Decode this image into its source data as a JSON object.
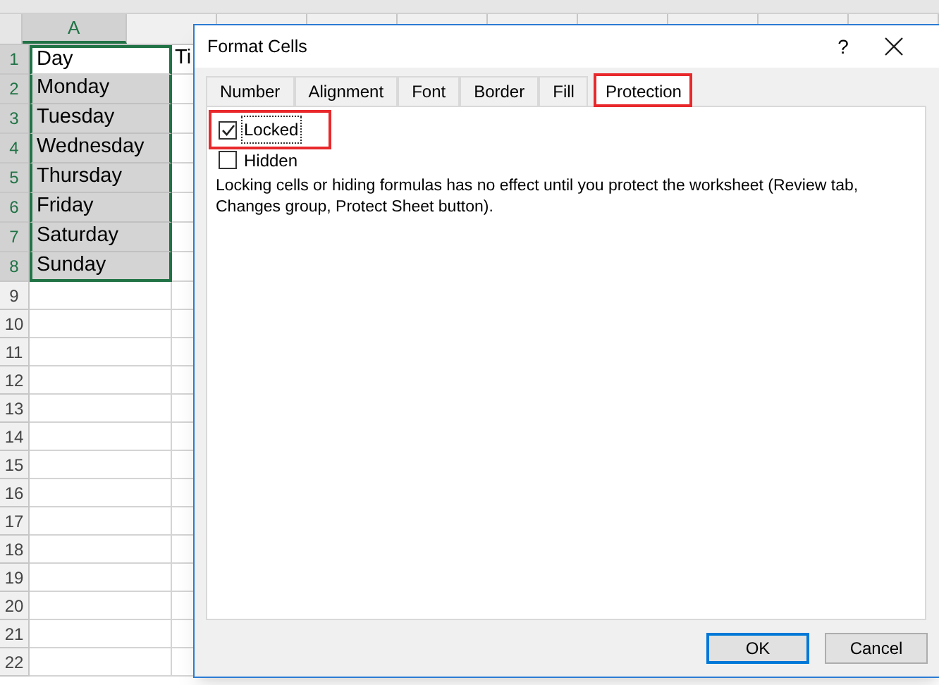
{
  "sheet": {
    "column_header": {
      "label": "A",
      "selected": true
    },
    "rows": [
      {
        "number": "1",
        "selected": true,
        "highlighted": false,
        "cells": [
          "Day",
          "Ti"
        ]
      },
      {
        "number": "2",
        "selected": true,
        "highlighted": true,
        "cells": [
          "Monday"
        ]
      },
      {
        "number": "3",
        "selected": true,
        "highlighted": true,
        "cells": [
          "Tuesday"
        ]
      },
      {
        "number": "4",
        "selected": true,
        "highlighted": true,
        "cells": [
          "Wednesday"
        ]
      },
      {
        "number": "5",
        "selected": true,
        "highlighted": true,
        "cells": [
          "Thursday"
        ]
      },
      {
        "number": "6",
        "selected": true,
        "highlighted": true,
        "cells": [
          "Friday"
        ]
      },
      {
        "number": "7",
        "selected": true,
        "highlighted": true,
        "cells": [
          "Saturday"
        ]
      },
      {
        "number": "8",
        "selected": true,
        "highlighted": true,
        "cells": [
          "Sunday"
        ]
      },
      {
        "number": "9",
        "selected": false,
        "highlighted": false,
        "cells": []
      },
      {
        "number": "10",
        "selected": false,
        "highlighted": false,
        "cells": []
      },
      {
        "number": "11",
        "selected": false,
        "highlighted": false,
        "cells": []
      },
      {
        "number": "12",
        "selected": false,
        "highlighted": false,
        "cells": []
      },
      {
        "number": "13",
        "selected": false,
        "highlighted": false,
        "cells": []
      },
      {
        "number": "14",
        "selected": false,
        "highlighted": false,
        "cells": []
      },
      {
        "number": "15",
        "selected": false,
        "highlighted": false,
        "cells": []
      },
      {
        "number": "16",
        "selected": false,
        "highlighted": false,
        "cells": []
      },
      {
        "number": "17",
        "selected": false,
        "highlighted": false,
        "cells": []
      },
      {
        "number": "18",
        "selected": false,
        "highlighted": false,
        "cells": []
      },
      {
        "number": "19",
        "selected": false,
        "highlighted": false,
        "cells": []
      },
      {
        "number": "20",
        "selected": false,
        "highlighted": false,
        "cells": []
      },
      {
        "number": "21",
        "selected": false,
        "highlighted": false,
        "cells": []
      },
      {
        "number": "22",
        "selected": false,
        "highlighted": false,
        "cells": []
      }
    ]
  },
  "dialog": {
    "title": "Format Cells",
    "help": "?",
    "tabs": [
      {
        "label": "Number",
        "selected": false,
        "highlighted": false
      },
      {
        "label": "Alignment",
        "selected": false,
        "highlighted": false
      },
      {
        "label": "Font",
        "selected": false,
        "highlighted": false
      },
      {
        "label": "Border",
        "selected": false,
        "highlighted": false
      },
      {
        "label": "Fill",
        "selected": false,
        "highlighted": false
      },
      {
        "label": "Protection",
        "selected": true,
        "highlighted": true
      }
    ],
    "checkboxes": [
      {
        "label": "Locked",
        "checked": true,
        "focused": true,
        "highlighted": true
      },
      {
        "label": "Hidden",
        "checked": false,
        "focused": false,
        "highlighted": false
      }
    ],
    "note": "Locking cells or hiding formulas has no effect until you protect the worksheet (Review tab, Changes group, Protect Sheet button).",
    "buttons": [
      {
        "label": "OK",
        "kind": "default"
      },
      {
        "label": "Cancel",
        "kind": "normal"
      }
    ]
  }
}
